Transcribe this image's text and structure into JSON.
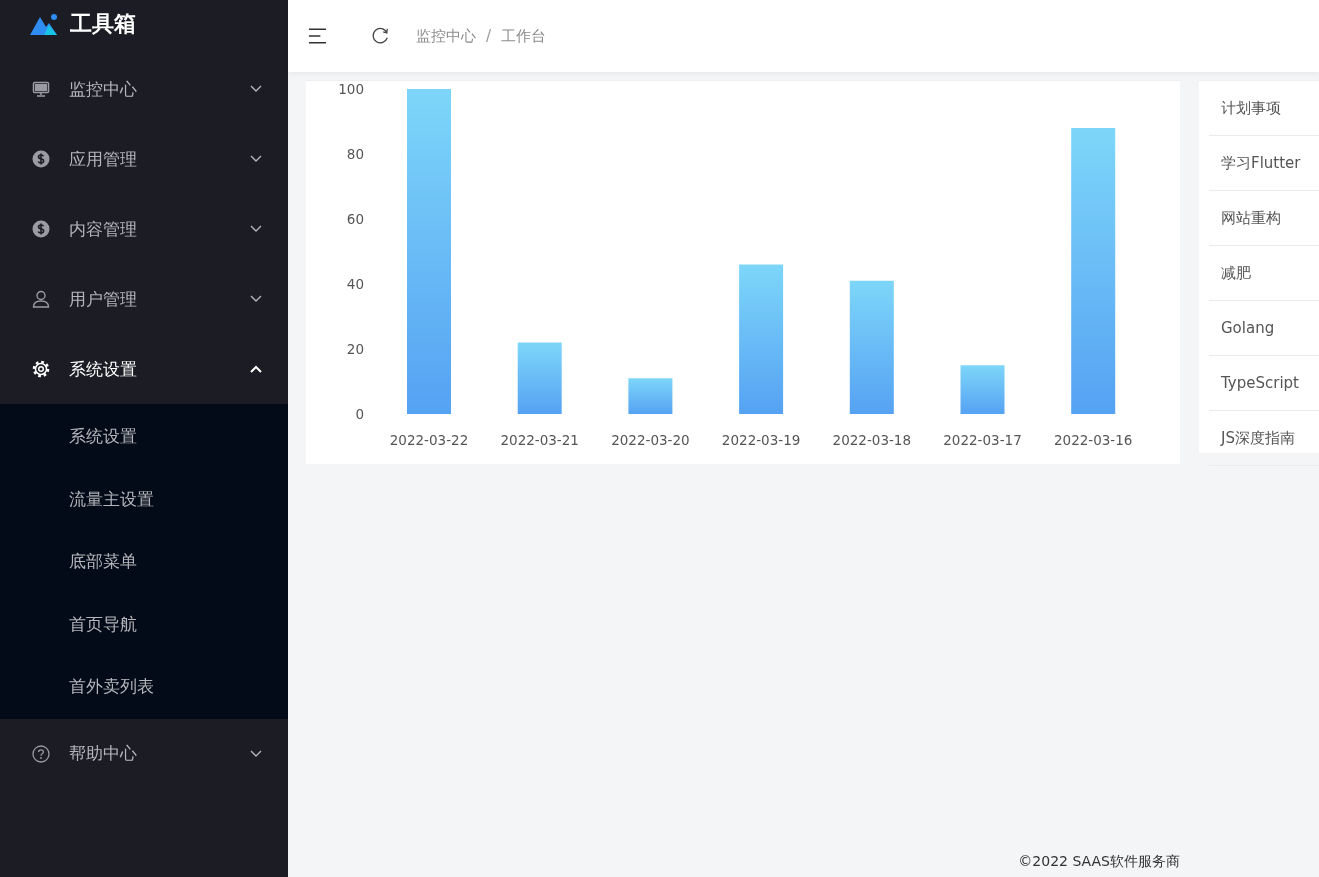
{
  "sidebar": {
    "logo": "工具箱",
    "menu": [
      {
        "label": "监控中心",
        "expanded": false
      },
      {
        "label": "应用管理",
        "expanded": false
      },
      {
        "label": "内容管理",
        "expanded": false
      },
      {
        "label": "用户管理",
        "expanded": false
      },
      {
        "label": "系统设置",
        "expanded": true,
        "children": [
          {
            "label": "系统设置"
          },
          {
            "label": "流量主设置"
          },
          {
            "label": "底部菜单"
          },
          {
            "label": "首页导航"
          },
          {
            "label": "首外卖列表"
          }
        ]
      },
      {
        "label": "帮助中心",
        "expanded": false
      }
    ]
  },
  "header": {
    "breadcrumb": [
      "监控中心",
      "工作台"
    ],
    "separator": "/"
  },
  "chart": {
    "chart_data": {
      "type": "bar",
      "categories": [
        "2022-03-22",
        "2022-03-21",
        "2022-03-20",
        "2022-03-19",
        "2022-03-18",
        "2022-03-17",
        "2022-03-16"
      ],
      "values": [
        100,
        22,
        11,
        46,
        41,
        15,
        88
      ],
      "ylim": [
        0,
        100
      ],
      "yticks": [
        0,
        20,
        40,
        60,
        80,
        100
      ]
    }
  },
  "todo_list": [
    "计划事项",
    "学习Flutter",
    "网站重构",
    "减肥",
    "Golang",
    "TypeScript",
    "JS深度指南"
  ],
  "footer": "©2022 SAAS软件服务商"
}
